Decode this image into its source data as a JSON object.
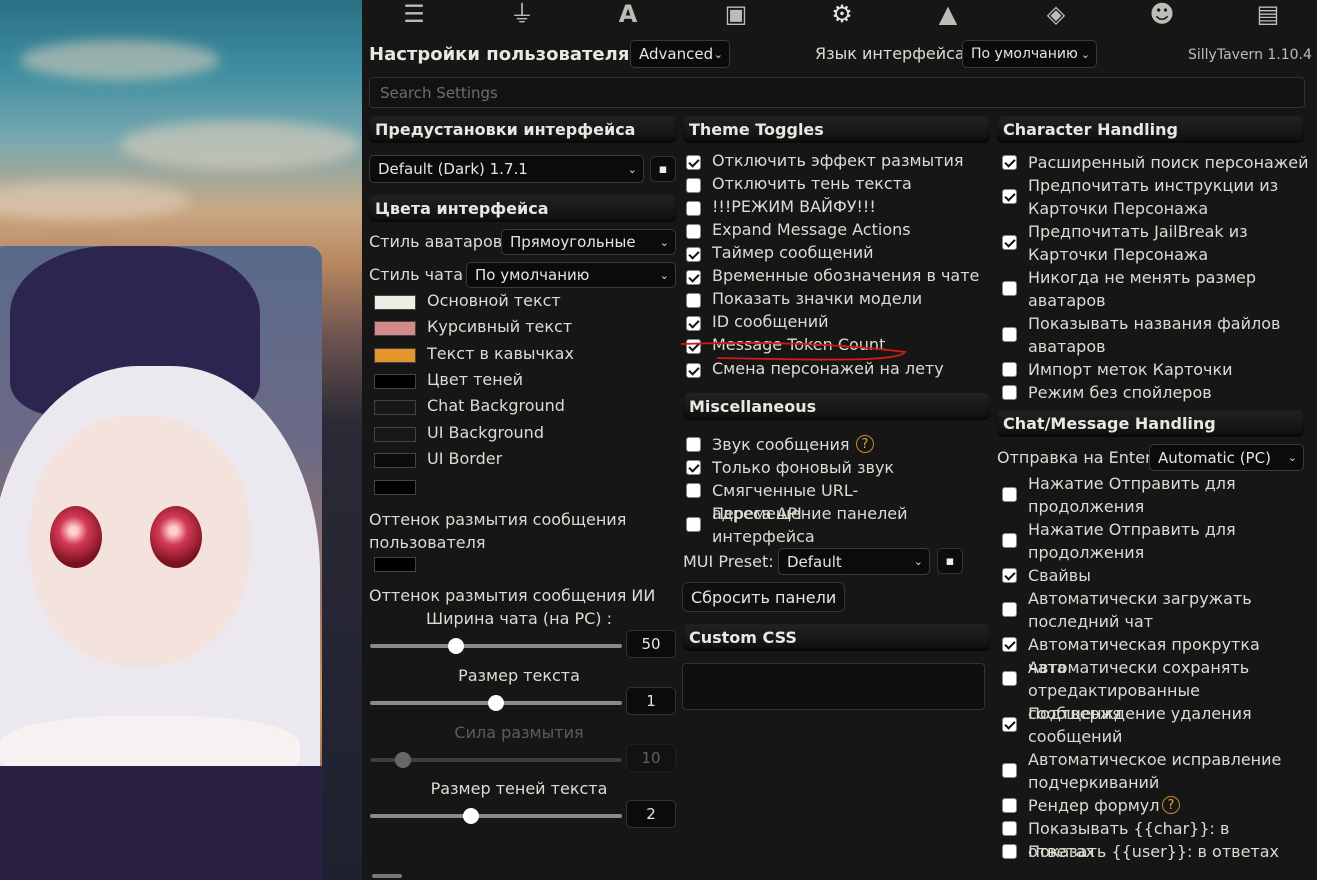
{
  "nav_icons": [
    "sliders-icon",
    "plug-icon",
    "font-icon",
    "book-icon",
    "user-settings-icon",
    "image-icon",
    "cubes-icon",
    "smiley-icon",
    "id-card-icon"
  ],
  "header": {
    "title": "Настройки пользователя",
    "mode": "Advanced",
    "lang_label": "Язык интерфейса",
    "lang_value": "По умолчанию",
    "version": "SillyTavern 1.10.4"
  },
  "search": {
    "placeholder": "Search Settings"
  },
  "col1": {
    "presets_title": "Предустановки интерфейса",
    "preset_value": "Default (Dark) 1.7.1",
    "colors_title": "Цвета интерфейса",
    "avatar_style_label": "Стиль аватаров",
    "avatar_style_value": "Прямоугольные",
    "chat_style_label": "Стиль чата",
    "chat_style_value": "По умолчанию",
    "colors": [
      {
        "label": "Основной текст",
        "color": "#eeeee4"
      },
      {
        "label": "Курсивный текст",
        "color": "#d48a8a"
      },
      {
        "label": "Текст в кавычках",
        "color": "#e3952c"
      },
      {
        "label": "Цвет теней",
        "color": "#000000"
      },
      {
        "label": "Chat Background",
        "color": "#171717"
      },
      {
        "label": "UI Background",
        "color": "#171717"
      },
      {
        "label": "UI Border",
        "color": "#0b0b0b"
      },
      {
        "label": "",
        "color": "#000000"
      }
    ],
    "user_blur_label": "Оттенок размытия сообщения пользователя",
    "ai_blur_label": "Оттенок размытия сообщения ИИ",
    "sliders": [
      {
        "label": "Ширина чата   (на PC)   :",
        "value": "50",
        "fraction": 0.34,
        "disabled": false
      },
      {
        "label": "Размер текста",
        "value": "1",
        "fraction": 0.5,
        "disabled": false
      },
      {
        "label": "Сила размытия",
        "value": "10",
        "fraction": 0.13,
        "disabled": true
      },
      {
        "label": "Размер теней текста",
        "value": "2",
        "fraction": 0.4,
        "disabled": false
      }
    ]
  },
  "col2": {
    "theme_title": "Theme Toggles",
    "theme_toggles": [
      {
        "label": "Отключить эффект размытия",
        "checked": true
      },
      {
        "label": "Отключить тень текста",
        "checked": false
      },
      {
        "label": "!!!РЕЖИМ ВАЙФУ!!!",
        "checked": false
      },
      {
        "label": "Expand Message Actions",
        "checked": false
      },
      {
        "label": "Таймер сообщений",
        "checked": true
      },
      {
        "label": "Временные обозначения в чате",
        "checked": true
      },
      {
        "label": "Показать значки модели",
        "checked": false
      },
      {
        "label": "ID сообщений",
        "checked": true
      },
      {
        "label": "Message Token Count",
        "checked": true
      },
      {
        "label": "Смена персонажей на лету",
        "checked": true
      }
    ],
    "misc_title": "Miscellaneous",
    "misc": [
      {
        "label": "Звук сообщения",
        "checked": false
      },
      {
        "label": "Только фоновый звук",
        "checked": true
      },
      {
        "label": "Смягченные URL-адреса API",
        "checked": false
      },
      {
        "label": "Перемещение панелей интерфейса",
        "checked": false
      }
    ],
    "mui_label": "MUI Preset:",
    "mui_value": "Default",
    "reset_button": "Сбросить панели",
    "css_title": "Custom CSS"
  },
  "col3": {
    "char_title": "Character Handling",
    "char_items": [
      {
        "label": "Расширенный поиск персонажей",
        "checked": true
      },
      {
        "label": "Предпочитать инструкции из Карточки Персонажа",
        "checked": true
      },
      {
        "label": "Предпочитать JailBreak из Карточки Персонажа",
        "checked": true
      },
      {
        "label": "Никогда не менять размер аватаров",
        "checked": false
      },
      {
        "label": "Показывать названия файлов аватаров",
        "checked": false
      },
      {
        "label": "Импорт меток Карточки",
        "checked": false
      },
      {
        "label": "Режим без спойлеров",
        "checked": false
      }
    ],
    "chat_title": "Chat/Message Handling",
    "send_label": "Отправка на Enter",
    "send_value": "Automatic (PC)",
    "chat_items": [
      {
        "label": "Нажатие Отправить для продолжения",
        "checked": false
      },
      {
        "label": "Нажатие Отправить для продолжения",
        "checked": false
      },
      {
        "label": "Свайвы",
        "checked": true
      },
      {
        "label": "Автоматически загружать последний чат",
        "checked": false
      },
      {
        "label": "Автоматическая прокрутка чата",
        "checked": true
      },
      {
        "label": "Автоматически сохранять отредактированные сообщения",
        "checked": false
      },
      {
        "label": "Подтверждение удаления сообщений",
        "checked": true
      },
      {
        "label": "Автоматическое исправление подчеркиваний",
        "checked": false
      },
      {
        "label": "Рендер формул",
        "checked": false
      },
      {
        "label": "Показывать {{char}}: в ответах",
        "checked": false
      },
      {
        "label": "Показать {{user}}: в ответах",
        "checked": false
      }
    ]
  },
  "accent_annotation_color": "#d11a1a"
}
